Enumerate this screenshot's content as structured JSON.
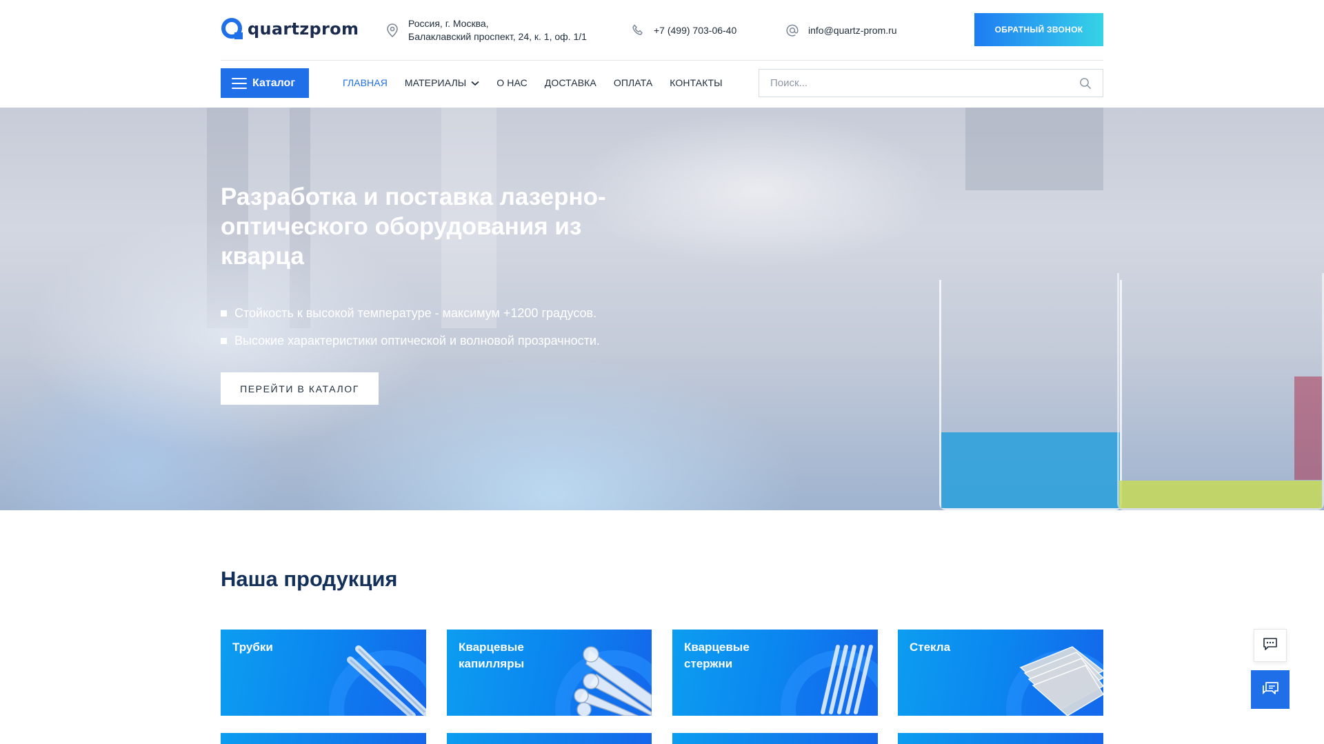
{
  "header": {
    "logo_text": "quartzprom",
    "address_line1": "Россия, г. Москва,",
    "address_line2": "Балаклавский проспект, 24, к. 1, оф. 1/1",
    "phone": "+7 (499) 703-06-40",
    "email": "info@quartz-prom.ru",
    "callback_label": "ОБРАТНЫЙ ЗВОНОК"
  },
  "nav": {
    "catalog_label": "Каталог",
    "items": [
      {
        "label": "ГЛАВНАЯ",
        "active": true
      },
      {
        "label": "МАТЕРИАЛЫ",
        "dropdown": true
      },
      {
        "label": "О НАС"
      },
      {
        "label": "ДОСТАВКА"
      },
      {
        "label": "ОПЛАТА"
      },
      {
        "label": "КОНТАКТЫ"
      }
    ],
    "search_placeholder": "Поиск..."
  },
  "hero": {
    "title": "Разработка и поставка лазерно-оптического оборудования из кварца",
    "bullets": [
      "Стойкость к высокой температуре - максимум +1200 градусов.",
      "Высокие характеристики оптической и волновой прозрачности."
    ],
    "button_label": "ПЕРЕЙТИ В КАТАЛОГ"
  },
  "products": {
    "title": "Наша продукция",
    "cards": [
      {
        "label": "Трубки",
        "icon": "tubes-icon"
      },
      {
        "label": "Кварцевые капилляры",
        "icon": "capillaries-icon"
      },
      {
        "label": "Кварцевые стержни",
        "icon": "rods-icon"
      },
      {
        "label": "Стекла",
        "icon": "glass-plates-icon"
      }
    ]
  },
  "colors": {
    "accent": "#1f6fe8",
    "title_dark": "#13305a",
    "card_gradient_start": "#0c9df0",
    "card_gradient_end": "#1466ea"
  }
}
